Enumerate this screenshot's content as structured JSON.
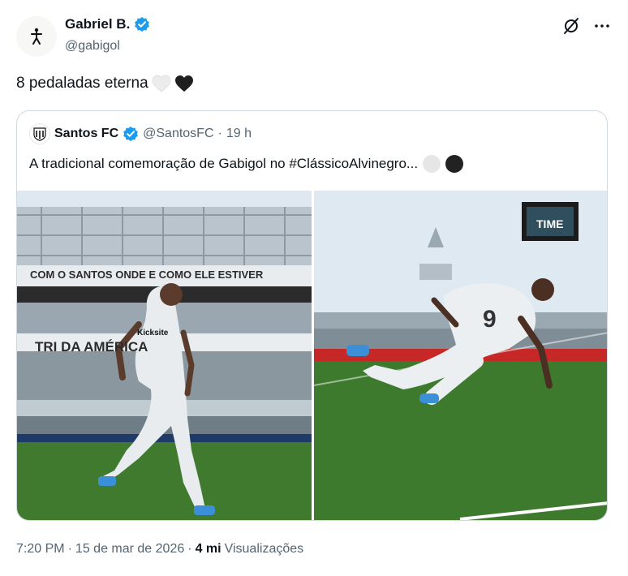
{
  "author": {
    "name": "Gabriel B.",
    "handle": "@gabigol",
    "avatar_icon": "player-silhouette-icon",
    "verified_color": "#1d9bf0"
  },
  "tweet": {
    "text": "8 pedaladas eterna",
    "emojis": [
      "white-heart-icon",
      "black-heart-icon"
    ]
  },
  "top_actions": [
    "grok-icon",
    "more-icon"
  ],
  "quote": {
    "name": "Santos FC",
    "handle": "@SantosFC",
    "separator": "·",
    "time": "19 h",
    "text": "A tradicional comemoração de Gabigol no #ClássicoAlvinegro...",
    "emojis": [
      "white-circle-icon",
      "black-circle-icon"
    ],
    "photos": [
      {
        "name": "photo-player-running",
        "banner_top": "COM O SANTOS ONDE E COMO ELE ESTIVER",
        "banner_mid": "TRI DA AMÉRICA",
        "shirt_sponsor": "Kicksite"
      },
      {
        "name": "photo-player-celebration",
        "scoreboard": "TIME",
        "shirt_number": "9"
      }
    ]
  },
  "footer": {
    "time": "7:20 PM",
    "sep1": "·",
    "date": "15 de mar de 2026",
    "sep2": "·",
    "views_count": "4 mi",
    "views_label": "Visualizações"
  }
}
